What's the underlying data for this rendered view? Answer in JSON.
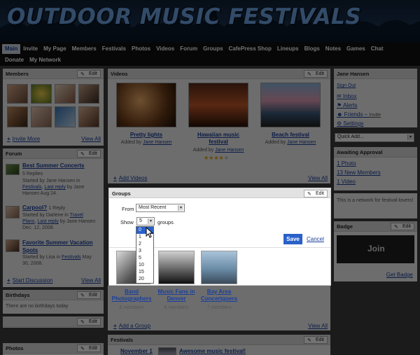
{
  "site": {
    "title": "OUTDOOR MUSIC FESTIVALS"
  },
  "nav": {
    "row1": [
      "Main",
      "Invite",
      "My Page",
      "Members",
      "Festivals",
      "Photos",
      "Videos",
      "Forum",
      "Groups",
      "CafePress Shop",
      "Lineups",
      "Blogs",
      "Notes",
      "Games",
      "Chat"
    ],
    "row2": [
      "Donate",
      "My Network"
    ],
    "active": "Main"
  },
  "common": {
    "edit_label": "Edit",
    "view_all": "View All"
  },
  "members": {
    "title": "Members",
    "invite_more": "Invite More"
  },
  "forum": {
    "title": "Forum",
    "posts": [
      {
        "title": "Best Summer Concerts",
        "replies": "5 Replies",
        "l1": "Started by Jane Hansen in",
        "l2a": "Festivals",
        "l2b": "Last reply",
        "l2c": "by Jane",
        "l3": "Hansen Aug 24."
      },
      {
        "title": "Carpool?",
        "replies": "1 Reply",
        "l1": "Started by Darlene in",
        "l1b": "Travel",
        "l2a": "Plans",
        "l2b": "Last reply",
        "l2c": "by Jane Hansen",
        "l3": "Dec. 12, 2008."
      },
      {
        "title": "Favorite Summer Vacation Spots",
        "l1": "Started by Lisa in",
        "l1b": "Festivals",
        "l1c": "May",
        "l2": "30, 2008."
      }
    ],
    "start_discussion": "Start Discussion"
  },
  "birthdays": {
    "title": "Birthdays",
    "text": "There are no birthdays today"
  },
  "photos_left": {
    "title": "Photos"
  },
  "videos": {
    "title": "Videos",
    "items": [
      {
        "title": "Pretty lights",
        "added": "Added by",
        "by": "Jane Hansen"
      },
      {
        "title": "Hawaiian music festival",
        "added": "Added by",
        "by": "Jane Hansen"
      },
      {
        "title": "Beach festival",
        "added": "Added by",
        "by": "Jane Hansen"
      }
    ],
    "add": "Add Videos"
  },
  "groups_modal": {
    "title": "Groups",
    "from_label": "From",
    "from_value": "Most Recent",
    "show_label": "Show",
    "show_value": "5",
    "show_suffix": "groups",
    "options": [
      "0",
      "1",
      "2",
      "3",
      "5",
      "10",
      "15",
      "20"
    ],
    "highlighted": "0",
    "save": "Save",
    "cancel": "Cancel",
    "groups": [
      {
        "name": "Band Photographers",
        "members": "6 members"
      },
      {
        "name": "Music Fans in Denver",
        "members": "6 members"
      },
      {
        "name": "Bay Area Concertgoers",
        "members": "7 members"
      }
    ],
    "add_group": "Add a Group"
  },
  "festivals": {
    "title": "Festivals",
    "date": "November 1",
    "event": "Awesome music festival!"
  },
  "user": {
    "name": "Jane Hansen",
    "sign_out": "Sign Out",
    "links": [
      "Inbox",
      "Alerts",
      "Friends",
      "Settings"
    ],
    "invite": "Invite",
    "quick_add": "Quick Add..."
  },
  "approval": {
    "title": "Awaiting Approval",
    "items": [
      "1 Photo",
      "13 New Members",
      "1 Video"
    ]
  },
  "network_text": "This is a network for festival-lovers!",
  "badge": {
    "title": "Badge",
    "join": "Join",
    "get": "Get Badge"
  }
}
